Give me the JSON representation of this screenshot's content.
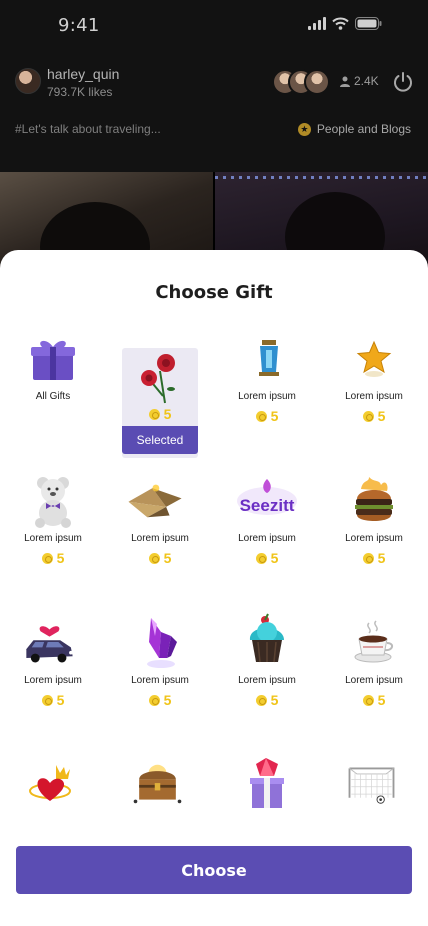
{
  "status": {
    "time": "9:41"
  },
  "host": {
    "name": "harley_quin",
    "likes": "793.7K likes"
  },
  "viewers": {
    "count": "2.4K"
  },
  "live": {
    "topic": "#Let's talk about traveling...",
    "category": "People and Blogs"
  },
  "sheet": {
    "title": "Choose Gift",
    "selected_badge": "Selected",
    "choose_label": "Choose"
  },
  "gifts": [
    {
      "label": "All Gifts",
      "price": null,
      "icon": "gift-box-icon"
    },
    {
      "label": null,
      "price": "5",
      "icon": "rose-icon",
      "selected": true
    },
    {
      "label": "Lorem ipsum",
      "price": "5",
      "icon": "lantern-icon"
    },
    {
      "label": "Lorem ipsum",
      "price": "5",
      "icon": "star-icon"
    },
    {
      "label": "Lorem ipsum",
      "price": "5",
      "icon": "teddy-bear-icon"
    },
    {
      "label": "Lorem ipsum",
      "price": "5",
      "icon": "pyramid-icon"
    },
    {
      "label": "Lorem ipsum",
      "price": "5",
      "icon": "seezitt-logo-icon",
      "logo_text": "Seezitt"
    },
    {
      "label": "Lorem ipsum",
      "price": "5",
      "icon": "burger-icon"
    },
    {
      "label": "Lorem ipsum",
      "price": "5",
      "icon": "car-icon"
    },
    {
      "label": "Lorem ipsum",
      "price": "5",
      "icon": "crystal-icon"
    },
    {
      "label": "Lorem ipsum",
      "price": "5",
      "icon": "cupcake-icon"
    },
    {
      "label": "Lorem ipsum",
      "price": "5",
      "icon": "coffee-cup-icon"
    },
    {
      "label": null,
      "price": null,
      "icon": "crowned-heart-icon"
    },
    {
      "label": null,
      "price": null,
      "icon": "treasure-chest-icon"
    },
    {
      "label": null,
      "price": null,
      "icon": "gem-box-icon"
    },
    {
      "label": null,
      "price": null,
      "icon": "soccer-goal-icon"
    }
  ],
  "colors": {
    "accent": "#5B4DB3",
    "coin": "#F0C419",
    "selected_bg": "#EBE9F3"
  }
}
